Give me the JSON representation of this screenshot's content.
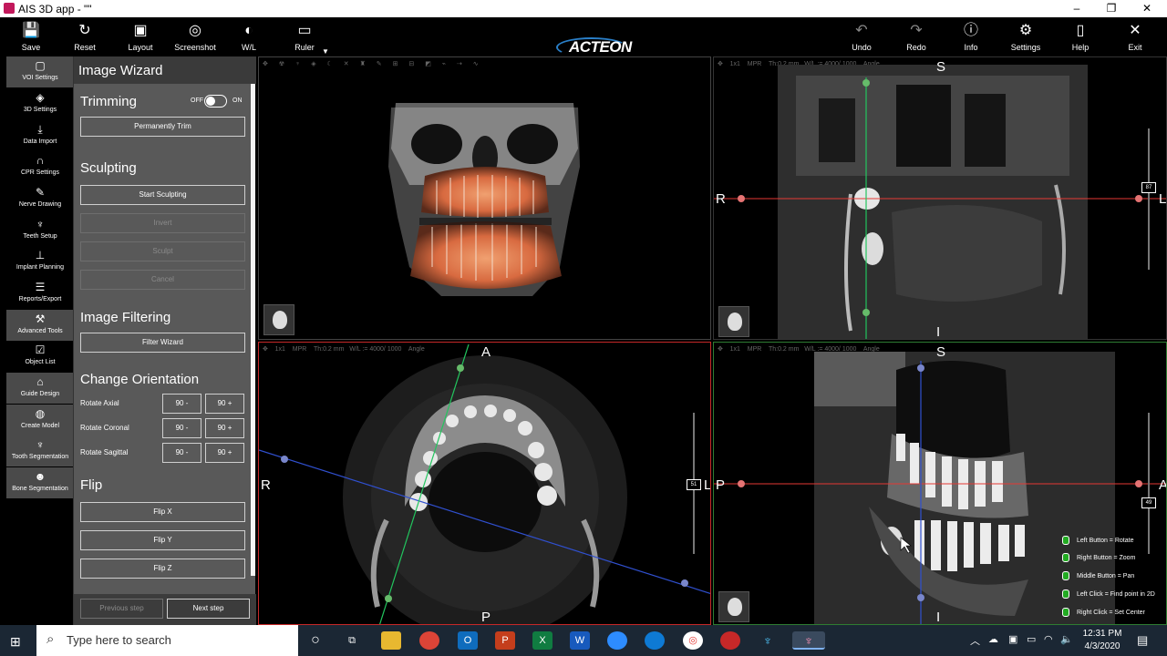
{
  "window": {
    "title": "AIS 3D app - \"\"",
    "min": "–",
    "max": "❐",
    "close": "✕"
  },
  "toolbar": {
    "left": [
      {
        "label": "Save",
        "icon": "save-icon",
        "glyph": "💾"
      },
      {
        "label": "Reset",
        "icon": "reset-icon",
        "glyph": "↻"
      },
      {
        "label": "Layout",
        "icon": "layout-icon",
        "glyph": "▣"
      },
      {
        "label": "Screenshot",
        "icon": "camera-icon",
        "glyph": "◎"
      },
      {
        "label": "W/L",
        "icon": "contrast-icon",
        "glyph": "◐"
      },
      {
        "label": "Ruler",
        "icon": "ruler-icon",
        "glyph": "▭"
      }
    ],
    "brand": "ACTEON",
    "right": [
      {
        "label": "Undo",
        "icon": "undo-icon",
        "glyph": "↶"
      },
      {
        "label": "Redo",
        "icon": "redo-icon",
        "glyph": "↷"
      },
      {
        "label": "Info",
        "icon": "info-icon",
        "glyph": "ⓘ"
      },
      {
        "label": "Settings",
        "icon": "gear-icon",
        "glyph": "⚙"
      },
      {
        "label": "Help",
        "icon": "book-icon",
        "glyph": "▯"
      },
      {
        "label": "Exit",
        "icon": "exit-icon",
        "glyph": "✕"
      }
    ]
  },
  "sidebar": [
    {
      "label": "VOI Settings",
      "icon": "voi-icon",
      "glyph": "▢"
    },
    {
      "label": "3D Settings",
      "icon": "cube-icon",
      "glyph": "◈"
    },
    {
      "label": "Data Import",
      "icon": "download-icon",
      "glyph": "⤓"
    },
    {
      "label": "CPR Settings",
      "icon": "arch-icon",
      "glyph": "∩"
    },
    {
      "label": "Nerve Drawing",
      "icon": "nerve-icon",
      "glyph": "✎"
    },
    {
      "label": "Teeth Setup",
      "icon": "tooth-icon",
      "glyph": "♆"
    },
    {
      "label": "Implant Planning",
      "icon": "implant-icon",
      "glyph": "⊥"
    },
    {
      "label": "Reports/Export",
      "icon": "report-icon",
      "glyph": "☰"
    },
    {
      "label": "Advanced Tools",
      "icon": "tools-icon",
      "glyph": "⚒"
    },
    {
      "label": "Object List",
      "icon": "list-icon",
      "glyph": "☑"
    },
    {
      "label": "Guide Design",
      "icon": "guide-icon",
      "glyph": "⌂"
    },
    {
      "label": "Create Model",
      "icon": "model-icon",
      "glyph": "◍"
    },
    {
      "label": "Tooth Segmentation",
      "icon": "tooth-seg-icon",
      "glyph": "♆"
    },
    {
      "label": "Bone Segmentation",
      "icon": "bone-seg-icon",
      "glyph": "☻"
    }
  ],
  "wizard": {
    "title": "Image Wizard",
    "trimming": {
      "title": "Trimming",
      "off": "OFF",
      "on": "ON",
      "permanently_trim": "Permanently Trim"
    },
    "sculpting": {
      "title": "Sculpting",
      "start": "Start Sculpting",
      "invert": "Invert",
      "sculpt": "Sculpt",
      "cancel": "Cancel"
    },
    "filtering": {
      "title": "Image Filtering",
      "filter_wizard": "Filter Wizard"
    },
    "orientation": {
      "title": "Change Orientation",
      "rows": [
        {
          "label": "Rotate Axial",
          "minus": "90 -",
          "plus": "90 +"
        },
        {
          "label": "Rotate Coronal",
          "minus": "90 -",
          "plus": "90 +"
        },
        {
          "label": "Rotate Sagittal",
          "minus": "90 -",
          "plus": "90 +"
        }
      ]
    },
    "flip": {
      "title": "Flip",
      "x": "Flip X",
      "y": "Flip Y",
      "z": "Flip Z"
    },
    "prev": "Previous step",
    "next": "Next step"
  },
  "views": {
    "toolbar_text": {
      "size": "1x1",
      "mode": "MPR",
      "thickness": "Th:0.2 mm",
      "wl": "W/L := 4000/ 1000",
      "angle": "Angle"
    },
    "coronal": {
      "top": "S",
      "bottom": "I",
      "left": "R",
      "right": "L",
      "slider": "87"
    },
    "axial": {
      "top": "A",
      "bottom": "P",
      "left": "R",
      "right": "L",
      "slider": "51"
    },
    "sagittal": {
      "top": "S",
      "bottom": "I",
      "left": "P",
      "right": "A",
      "slider": "49"
    }
  },
  "mouse_legend": [
    "Left Button = Rotate",
    "Right Button = Zoom",
    "Middle Button = Pan",
    "Left Click = Find point in 2D",
    "Right Click = Set Center"
  ],
  "taskbar": {
    "search_placeholder": "Type here to search",
    "time": "12:31 PM",
    "date": "4/3/2020"
  },
  "colors": {
    "green": "#22c55e",
    "red": "#e53935",
    "blue": "#3050d0",
    "panel": "#595959",
    "brand_blue": "#2a7fc8"
  }
}
